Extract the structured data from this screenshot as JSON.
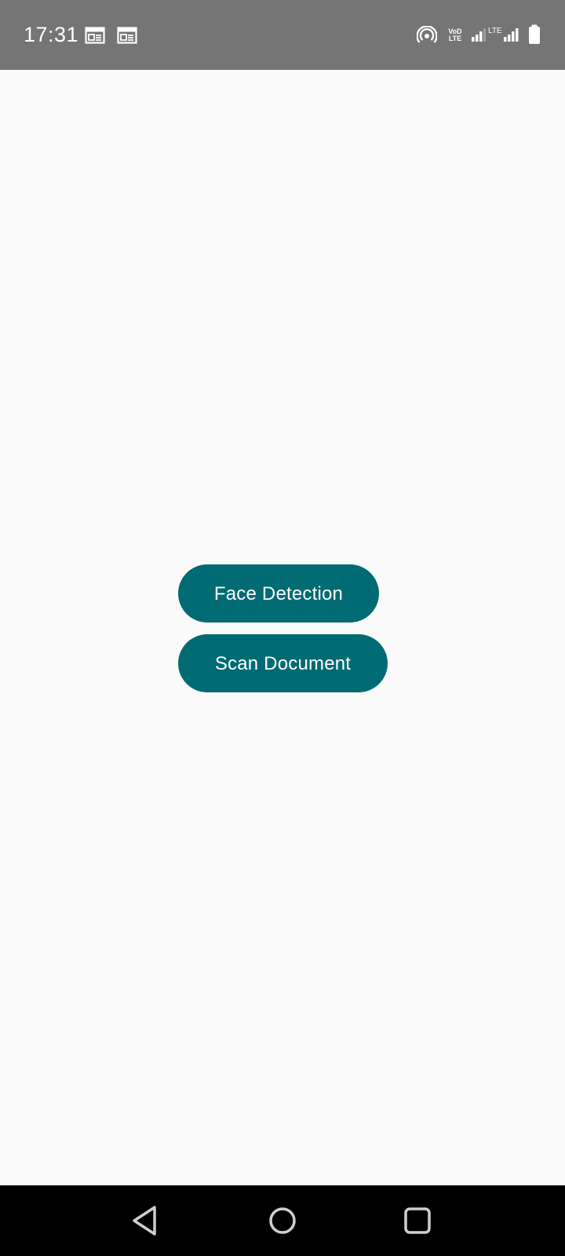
{
  "status_bar": {
    "time": "17:31",
    "left_icons": [
      "calendar-icon",
      "calendar-icon"
    ],
    "right_icons": [
      "hotspot-icon",
      "volte-icon",
      "signal-icon",
      "lte-signal-icon",
      "battery-icon"
    ],
    "volte_label": "VoD LTE",
    "lte_label": "LTE"
  },
  "main": {
    "buttons": {
      "face_detection": "Face Detection",
      "scan_document": "Scan Document"
    },
    "accent_color": "#006b73"
  },
  "nav_bar": {
    "icons": [
      "back-icon",
      "home-icon",
      "recents-icon"
    ]
  }
}
